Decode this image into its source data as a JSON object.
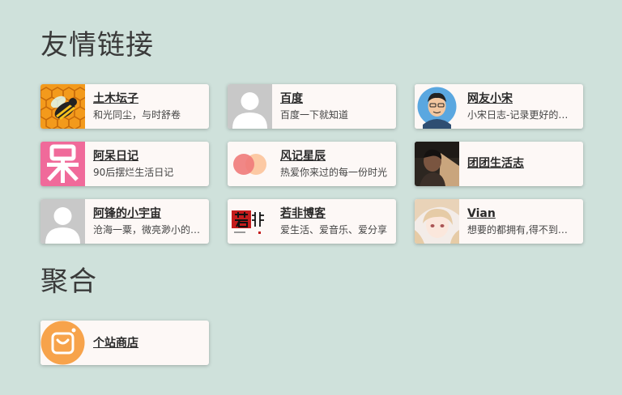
{
  "sections": {
    "friends_title": "友情链接",
    "agg_title": "聚合"
  },
  "friends": [
    {
      "name": "土木坛子",
      "desc": "和光同尘，与时舒卷",
      "icon": "bee-avatar-icon"
    },
    {
      "name": "百度",
      "desc": "百度一下就知道",
      "icon": "default-user-avatar-icon"
    },
    {
      "name": "网友小宋",
      "desc": "小宋日志-记录更好的生活",
      "icon": "cartoon-man-avatar-icon"
    },
    {
      "name": "阿呆日记",
      "desc": "90后摆烂生活日记",
      "icon": "dai-character-avatar-icon"
    },
    {
      "name": "风记星辰",
      "desc": "热爱你来过的每一份时光",
      "icon": "overlapping-circles-avatar-icon"
    },
    {
      "name": "团团生活志",
      "desc": "",
      "icon": "photo-avatar-icon"
    },
    {
      "name": "阿锋的小宇宙",
      "desc": "沧海一粟，微亮渺小的宇宙",
      "icon": "default-user-avatar-icon"
    },
    {
      "name": "若非博客",
      "desc": "爱生活、爱音乐、爱分享",
      "icon": "ruofei-logo-icon"
    },
    {
      "name": "Vian",
      "desc": "想要的都拥有,得不到的都释怀",
      "icon": "anime-girl-avatar-icon"
    }
  ],
  "aggregation": [
    {
      "name": "个站商店",
      "desc": "",
      "icon": "shopping-bag-avatar-icon"
    }
  ],
  "colors": {
    "background": "#cfe1db",
    "card": "#fdf8f6",
    "shop_orange": "#f7a34b"
  }
}
